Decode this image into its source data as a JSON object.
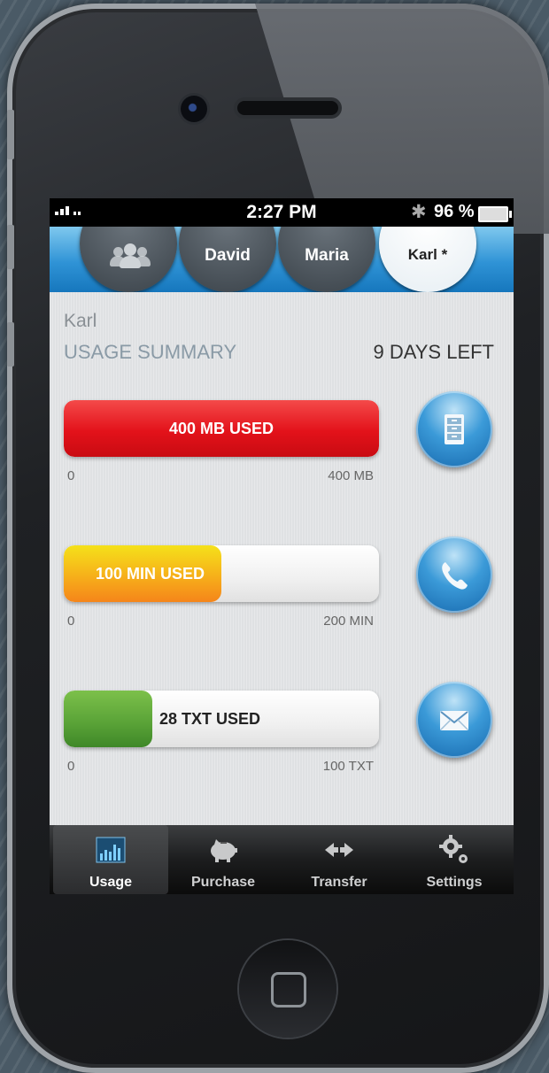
{
  "status_bar": {
    "time": "2:27 PM",
    "battery": "96 %"
  },
  "account_tabs": [
    {
      "label": "",
      "icon": "group-icon"
    },
    {
      "label": "David"
    },
    {
      "label": "Maria"
    },
    {
      "label": "Karl *",
      "active": true
    }
  ],
  "summary": {
    "owner": "Karl",
    "title": "USAGE SUMMARY",
    "days_left": "9 DAYS LEFT"
  },
  "usage": {
    "data": {
      "label": "400 MB USED",
      "used": 400,
      "limit": 400,
      "min_label": "0",
      "max_label": "400 MB",
      "color": "#e3121a",
      "icon": "file-cabinet-icon"
    },
    "minutes": {
      "label": "100 MIN USED",
      "used": 100,
      "limit": 200,
      "min_label": "0",
      "max_label": "200 MIN",
      "color": "#f6b41a",
      "icon": "phone-icon"
    },
    "texts": {
      "label": "28 TXT USED",
      "used": 28,
      "limit": 100,
      "min_label": "0",
      "max_label": "100 TXT",
      "color": "#5ba438",
      "icon": "envelope-icon"
    }
  },
  "tab_bar": [
    {
      "label": "Usage",
      "icon": "bar-chart-icon",
      "selected": true
    },
    {
      "label": "Purchase",
      "icon": "piggy-bank-icon"
    },
    {
      "label": "Transfer",
      "icon": "transfer-arrows-icon"
    },
    {
      "label": "Settings",
      "icon": "gears-icon"
    }
  ]
}
